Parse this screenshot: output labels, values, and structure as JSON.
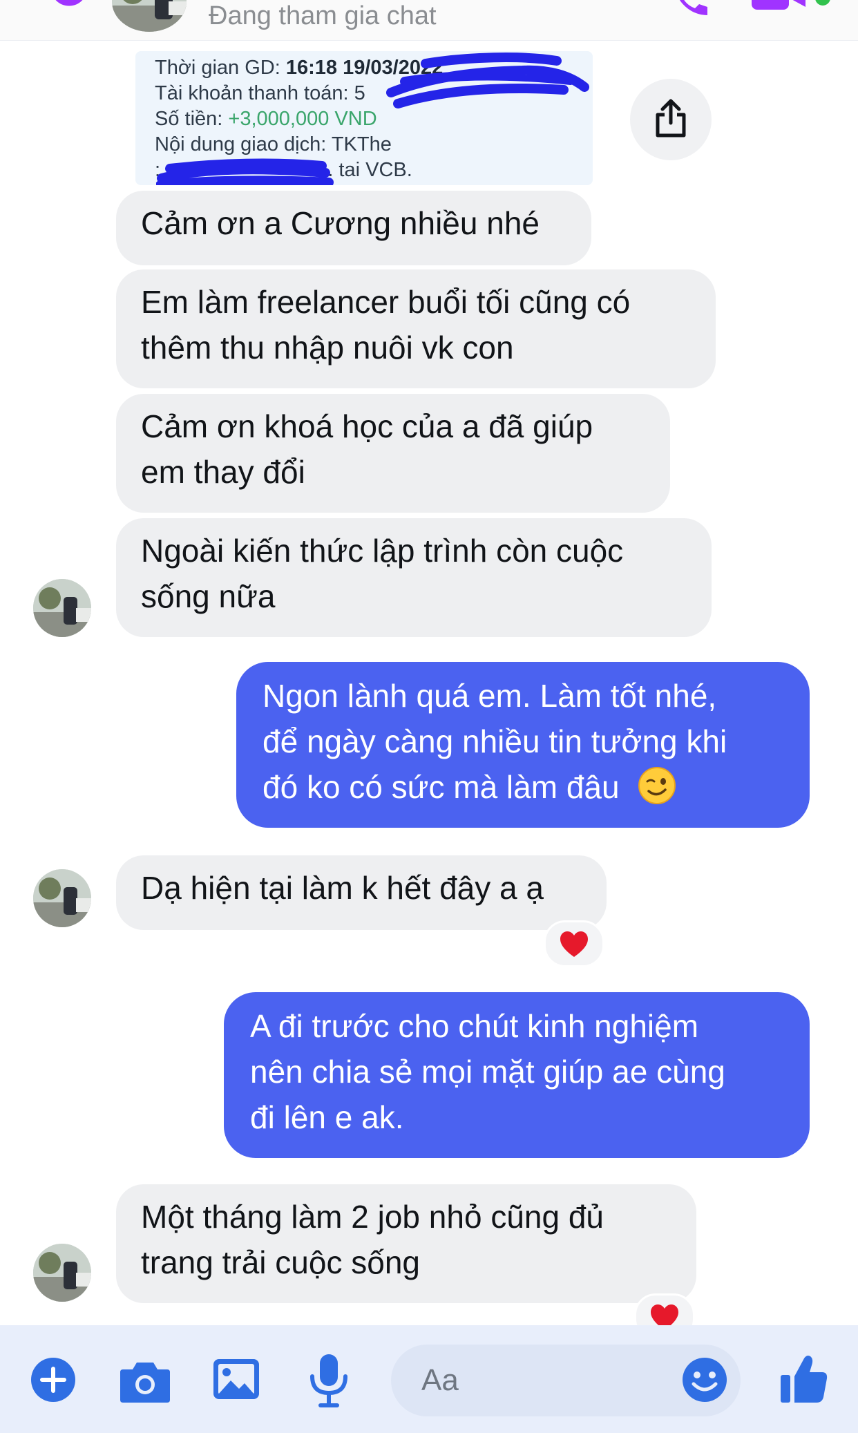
{
  "header": {
    "status": "Đang tham gia chat"
  },
  "receipt": {
    "time_label": "Thời gian GD:",
    "time_value": "16:18 19/03/2022",
    "account_label": "Tài khoản thanh toán:",
    "account_value": "5",
    "amount_label": "Số tiền:",
    "amount_value": "+3,000,000 VND",
    "content_label": "Nội dung giao dịch: TKThe",
    "content_line2": ":",
    "content_line2_tail": "51. tai VCB."
  },
  "messages": [
    {
      "side": "incoming",
      "lines": [
        "Cảm ơn a Cương nhiều nhé"
      ]
    },
    {
      "side": "incoming",
      "lines": [
        "Em làm freelancer buổi tối cũng có",
        "thêm thu nhập nuôi vk con"
      ]
    },
    {
      "side": "incoming",
      "lines": [
        "Cảm ơn khoá học của a đã giúp",
        "em thay đổi"
      ]
    },
    {
      "side": "incoming",
      "lines": [
        "Ngoài kiến thức lập trình còn cuộc",
        "sống nữa"
      ]
    },
    {
      "side": "outgoing",
      "lines": [
        "Ngon lành quá em. Làm tốt nhé,",
        "để ngày càng nhiều tin tưởng khi",
        "đó ko có sức mà làm đâu"
      ]
    },
    {
      "side": "incoming",
      "lines": [
        "Dạ hiện tại làm k hết đây a ạ"
      ]
    },
    {
      "side": "outgoing",
      "lines": [
        "A đi trước cho chút kinh nghiệm",
        "nên chia sẻ mọi mặt giúp ae cùng",
        "đi lên e ak."
      ]
    },
    {
      "side": "incoming",
      "lines": [
        "Một tháng làm 2 job nhỏ cũng đủ",
        "trang trải cuộc sống"
      ]
    }
  ],
  "composer": {
    "placeholder": "Aa"
  },
  "colors": {
    "outgoing_bubble": "#4b62f0",
    "incoming_bubble": "#eeeff1",
    "accent": "#4b62f0",
    "header_icons": "#a033ff",
    "reaction_heart": "#e6192b",
    "amount_green": "#3aa56b"
  },
  "icons": [
    "back-arrow-icon",
    "phone-icon",
    "video-camera-icon",
    "share-icon",
    "heart-icon",
    "winking-face-emoji",
    "plus-icon",
    "camera-icon",
    "image-icon",
    "microphone-icon",
    "smiley-icon",
    "thumbs-up-icon"
  ]
}
